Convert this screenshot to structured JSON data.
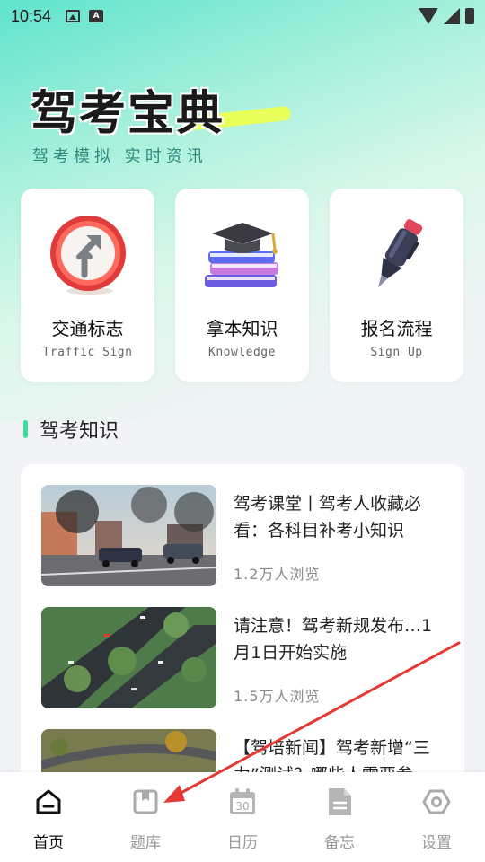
{
  "status_bar": {
    "time": "10:54",
    "left_icons": [
      "image-notification-icon",
      "a-notification-icon"
    ],
    "right_icons": [
      "wifi-icon",
      "signal-icon",
      "battery-icon"
    ]
  },
  "hero": {
    "title": "驾考宝典",
    "subtitle": "驾考模拟 实时资讯"
  },
  "feature_cards": [
    {
      "title": "交通标志",
      "subtitle": "Traffic Sign",
      "icon": "traffic-sign-icon"
    },
    {
      "title": "拿本知识",
      "subtitle": "Knowledge",
      "icon": "books-graduation-cap-icon"
    },
    {
      "title": "报名流程",
      "subtitle": "Sign Up",
      "icon": "pen-icon"
    }
  ],
  "section": {
    "title": "驾考知识"
  },
  "news": [
    {
      "title": "驾考课堂丨驾考人收藏必看：各科目补考小知识",
      "views": "1.2万人浏览",
      "thumb": "street-cars-photo"
    },
    {
      "title": "请注意！驾考新规发布…1月1日开始实施",
      "views": "1.5万人浏览",
      "thumb": "highway-aerial-photo"
    },
    {
      "title": "【驾培新闻】驾考新增“三力”测试？哪些人需要参",
      "views": "",
      "thumb": "interchange-aerial-photo"
    }
  ],
  "bottom_nav": [
    {
      "label": "首页",
      "icon": "home-icon",
      "active": true
    },
    {
      "label": "题库",
      "icon": "book-icon",
      "active": false
    },
    {
      "label": "日历",
      "icon": "calendar-icon",
      "active": false,
      "calendar_day": "30"
    },
    {
      "label": "备忘",
      "icon": "document-icon",
      "active": false
    },
    {
      "label": "设置",
      "icon": "settings-icon",
      "active": false
    }
  ],
  "colors": {
    "accent": "#3ddc9b",
    "annotation_arrow": "#e53935",
    "highlight": "#e9ff5a"
  }
}
